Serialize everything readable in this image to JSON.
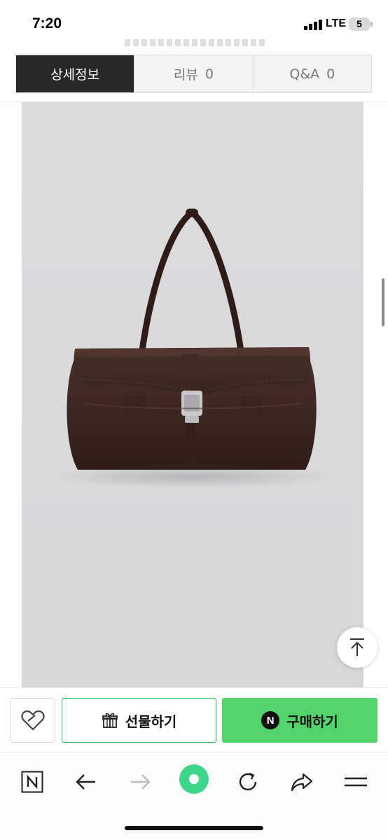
{
  "status_bar": {
    "time": "7:20",
    "network": "LTE",
    "battery": "5"
  },
  "tabs": [
    {
      "label": "상세정보",
      "count": ""
    },
    {
      "label": "리뷰",
      "count": "0"
    },
    {
      "label": "Q&A",
      "count": "0"
    }
  ],
  "product_image": {
    "subject": "dark brown leather shoulder bag"
  },
  "scroll_top": {
    "icon": "arrow-up-to-line-icon"
  },
  "buy_bar": {
    "wish_icon": "heart-icon",
    "gift_label": "선물하기",
    "gift_icon": "gift-icon",
    "buy_label": "구매하기",
    "buy_badge": "N",
    "accent": "#53d36b",
    "gift_border": "#19c251"
  },
  "browser_toolbar": {
    "items": [
      "naver-home-icon",
      "back-icon",
      "forward-icon",
      "green-dot-icon",
      "reload-icon",
      "share-icon",
      "menu-icon"
    ],
    "accent": "#3fd58a"
  }
}
